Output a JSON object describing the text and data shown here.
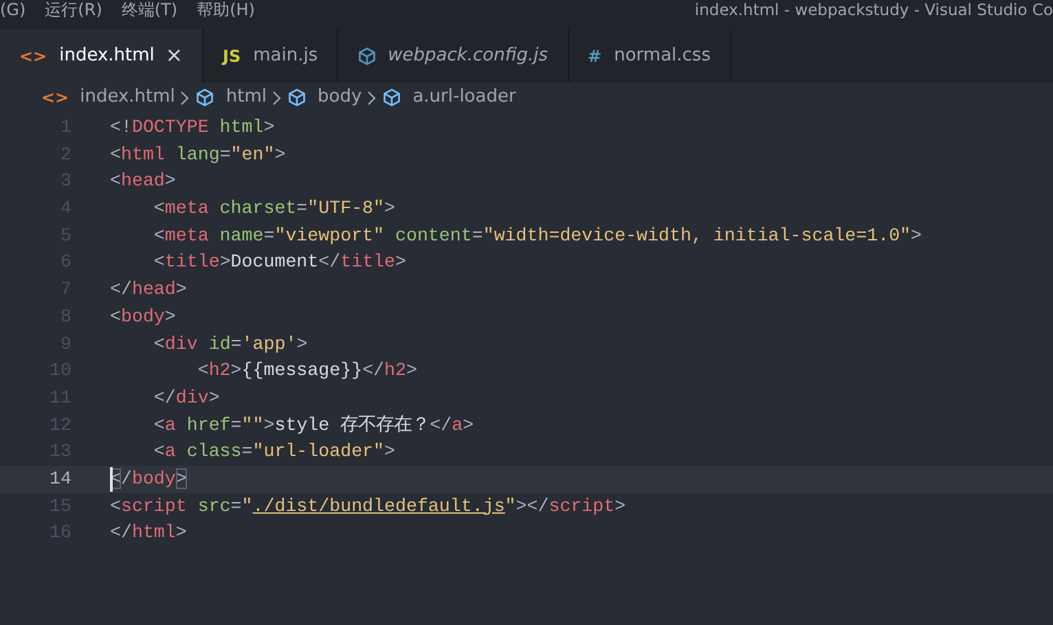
{
  "menu": [
    "(G)",
    "运行(R)",
    "终端(T)",
    "帮助(H)"
  ],
  "window": {
    "title": "index.html - webpackstudy - Visual Studio Co"
  },
  "tabs": [
    {
      "label": "index.html",
      "selected": true,
      "italic": false,
      "kind": "glyph",
      "glyph": "<>",
      "color": "#e37933",
      "close": "×"
    },
    {
      "label": "main.js",
      "selected": false,
      "italic": false,
      "kind": "glyph",
      "glyph": "JS",
      "color": "#cbcb41"
    },
    {
      "label": "webpack.config.js",
      "selected": false,
      "italic": true,
      "kind": "cube",
      "color": "#519aba"
    },
    {
      "label": "normal.css",
      "selected": false,
      "italic": false,
      "kind": "glyph",
      "glyph": "#",
      "color": "#519aba"
    }
  ],
  "breadcrumb": [
    {
      "label": "index.html",
      "kind": "file",
      "glyph": "<>"
    },
    {
      "label": "html",
      "kind": "element"
    },
    {
      "label": "body",
      "kind": "element"
    },
    {
      "label": "a.url-loader",
      "kind": "element"
    }
  ],
  "lines": [
    {
      "number": "1",
      "current": false,
      "tokens": [
        {
          "t": "<!",
          "kind": "punct"
        },
        {
          "t": "DOCTYPE",
          "kind": "tag"
        },
        {
          "t": " html",
          "kind": "attr"
        },
        {
          "t": ">",
          "kind": "punct"
        }
      ]
    },
    {
      "number": "2",
      "current": false,
      "tokens": [
        {
          "t": "<",
          "kind": "punct"
        },
        {
          "t": "html",
          "kind": "tag"
        },
        {
          "t": " lang",
          "kind": "attr"
        },
        {
          "t": "=",
          "kind": "punct"
        },
        {
          "t": "\"en\"",
          "kind": "string"
        },
        {
          "t": ">",
          "kind": "punct"
        }
      ]
    },
    {
      "number": "3",
      "current": false,
      "tokens": [
        {
          "t": "<",
          "kind": "punct"
        },
        {
          "t": "head",
          "kind": "tag"
        },
        {
          "t": ">",
          "kind": "punct"
        }
      ]
    },
    {
      "number": "4",
      "current": false,
      "tokens": [
        {
          "t": "    <",
          "kind": "punct"
        },
        {
          "t": "meta",
          "kind": "tag"
        },
        {
          "t": " charset",
          "kind": "attr"
        },
        {
          "t": "=",
          "kind": "punct"
        },
        {
          "t": "\"UTF-8\"",
          "kind": "string"
        },
        {
          "t": ">",
          "kind": "punct"
        }
      ]
    },
    {
      "number": "5",
      "current": false,
      "tokens": [
        {
          "t": "    <",
          "kind": "punct"
        },
        {
          "t": "meta",
          "kind": "tag"
        },
        {
          "t": " name",
          "kind": "attr"
        },
        {
          "t": "=",
          "kind": "punct"
        },
        {
          "t": "\"viewport\"",
          "kind": "string"
        },
        {
          "t": " content",
          "kind": "attr"
        },
        {
          "t": "=",
          "kind": "punct"
        },
        {
          "t": "\"width=device-width, initial-scale=1.0\"",
          "kind": "string"
        },
        {
          "t": ">",
          "kind": "punct"
        }
      ]
    },
    {
      "number": "6",
      "current": false,
      "tokens": [
        {
          "t": "    <",
          "kind": "punct"
        },
        {
          "t": "title",
          "kind": "tag"
        },
        {
          "t": ">",
          "kind": "punct"
        },
        {
          "t": "Document",
          "kind": "text"
        },
        {
          "t": "</",
          "kind": "punct"
        },
        {
          "t": "title",
          "kind": "tag"
        },
        {
          "t": ">",
          "kind": "punct"
        }
      ]
    },
    {
      "number": "7",
      "current": false,
      "tokens": [
        {
          "t": "</",
          "kind": "punct"
        },
        {
          "t": "head",
          "kind": "tag"
        },
        {
          "t": ">",
          "kind": "punct"
        }
      ]
    },
    {
      "number": "8",
      "current": false,
      "tokens": [
        {
          "t": "<",
          "kind": "punct"
        },
        {
          "t": "body",
          "kind": "tag"
        },
        {
          "t": ">",
          "kind": "punct"
        }
      ]
    },
    {
      "number": "9",
      "current": false,
      "tokens": [
        {
          "t": "    <",
          "kind": "punct"
        },
        {
          "t": "div",
          "kind": "tag"
        },
        {
          "t": " id",
          "kind": "attr"
        },
        {
          "t": "=",
          "kind": "punct"
        },
        {
          "t": "'app'",
          "kind": "string"
        },
        {
          "t": ">",
          "kind": "punct"
        }
      ]
    },
    {
      "number": "10",
      "current": false,
      "tokens": [
        {
          "t": "        <",
          "kind": "punct"
        },
        {
          "t": "h2",
          "kind": "tag"
        },
        {
          "t": ">",
          "kind": "punct"
        },
        {
          "t": "{{message}}",
          "kind": "text"
        },
        {
          "t": "</",
          "kind": "punct"
        },
        {
          "t": "h2",
          "kind": "tag"
        },
        {
          "t": ">",
          "kind": "punct"
        }
      ]
    },
    {
      "number": "11",
      "current": false,
      "tokens": [
        {
          "t": "    </",
          "kind": "punct"
        },
        {
          "t": "div",
          "kind": "tag"
        },
        {
          "t": ">",
          "kind": "punct"
        }
      ]
    },
    {
      "number": "12",
      "current": false,
      "tokens": [
        {
          "t": "    <",
          "kind": "punct"
        },
        {
          "t": "a",
          "kind": "tag"
        },
        {
          "t": " href",
          "kind": "attr"
        },
        {
          "t": "=",
          "kind": "punct"
        },
        {
          "t": "\"\"",
          "kind": "string"
        },
        {
          "t": ">",
          "kind": "punct"
        },
        {
          "t": "style 存不存在？",
          "kind": "text"
        },
        {
          "t": "</",
          "kind": "punct"
        },
        {
          "t": "a",
          "kind": "tag"
        },
        {
          "t": ">",
          "kind": "punct"
        }
      ]
    },
    {
      "number": "13",
      "current": false,
      "tokens": [
        {
          "t": "    <",
          "kind": "punct"
        },
        {
          "t": "a",
          "kind": "tag"
        },
        {
          "t": " class",
          "kind": "attr"
        },
        {
          "t": "=",
          "kind": "punct"
        },
        {
          "t": "\"url-loader\"",
          "kind": "string"
        },
        {
          "t": ">",
          "kind": "punct"
        }
      ]
    },
    {
      "number": "14",
      "current": true,
      "tokens": [
        {
          "t": "<",
          "kind": "punct",
          "matched": true
        },
        {
          "t": "/",
          "kind": "punct"
        },
        {
          "t": "body",
          "kind": "tag"
        },
        {
          "t": ">",
          "kind": "punct",
          "matched": true
        }
      ]
    },
    {
      "number": "15",
      "current": false,
      "tokens": [
        {
          "t": "<",
          "kind": "punct"
        },
        {
          "t": "script",
          "kind": "tag"
        },
        {
          "t": " src",
          "kind": "attr"
        },
        {
          "t": "=",
          "kind": "punct"
        },
        {
          "t": "\"",
          "kind": "string"
        },
        {
          "t": "./dist/bundledefault.js",
          "kind": "string",
          "link": true
        },
        {
          "t": "\"",
          "kind": "string"
        },
        {
          "t": "></",
          "kind": "punct"
        },
        {
          "t": "script",
          "kind": "tag"
        },
        {
          "t": ">",
          "kind": "punct"
        }
      ]
    },
    {
      "number": "16",
      "current": false,
      "tokens": [
        {
          "t": "</",
          "kind": "punct"
        },
        {
          "t": "html",
          "kind": "tag"
        },
        {
          "t": ">",
          "kind": "punct"
        }
      ]
    }
  ]
}
